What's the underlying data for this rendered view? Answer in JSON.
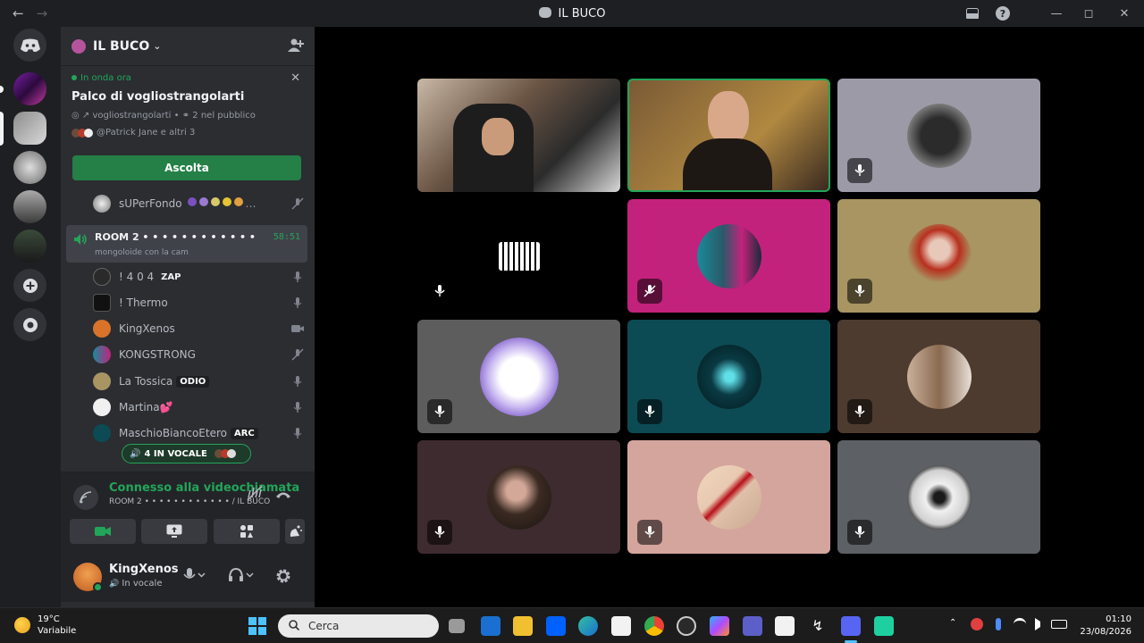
{
  "window": {
    "title": "IL BUCO"
  },
  "server": {
    "name": "IL BUCO"
  },
  "stage": {
    "live_label": "In onda ora",
    "title": "Palco di vogliostrangolarti",
    "host": "vogliostrangolarti",
    "audience": "2 nel pubblico",
    "listeners": "@Patrick Jane e altri 3",
    "listen_label": "Ascolta"
  },
  "voice_users_top": [
    {
      "name": "sUPerFondo"
    }
  ],
  "room": {
    "name": "ROOM 2 • • • • • • • • • • • •",
    "subtitle": "mongoloide con la cam",
    "timer": "58:51"
  },
  "voice_users": [
    {
      "name": "! 4 0 4",
      "badge": "ZAP"
    },
    {
      "name": "! Thermo"
    },
    {
      "name": "KingXenos"
    },
    {
      "name": "KONGSTRONG"
    },
    {
      "name": "La Tossica",
      "badge": "ODIO"
    },
    {
      "name": "Martina💕"
    },
    {
      "name": "MaschioBiancoEtero",
      "badge": "ARC"
    }
  ],
  "voice_pill": {
    "label": "4 IN VOCALE"
  },
  "voice_panel": {
    "status": "Connesso alla videochiamata",
    "location": "ROOM 2 • • • • • • • • • • • • / IL BUCO"
  },
  "user": {
    "name": "KingXenos",
    "status": "In vocale"
  },
  "taskbar": {
    "temp": "19°C",
    "weather": "Variabile",
    "search_placeholder": "Cerca",
    "time": "01:10",
    "date": "23/08/2026"
  },
  "colors": {
    "accent_green": "#23a559",
    "listen_button": "#248046",
    "tile_colors": [
      "#5a4636",
      "#6b5230",
      "#9d9aa8",
      "#000000",
      "#c2227c",
      "#a89562",
      "#5d5d5d",
      "#0c4b53",
      "#4d3b30",
      "#3e2b2f",
      "#d4a59d",
      "#5d6064"
    ]
  }
}
